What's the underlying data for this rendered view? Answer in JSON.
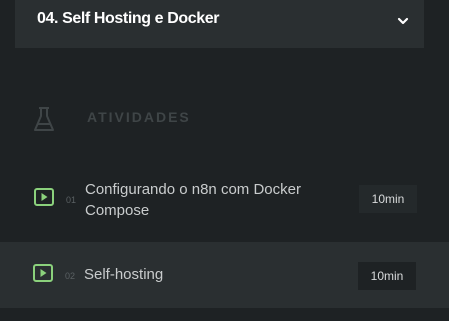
{
  "module": {
    "title": "04. Self Hosting e Docker",
    "toggle_icon": "chevron-down-icon"
  },
  "section": {
    "icon": "flask-icon",
    "label": "ATIVIDADES"
  },
  "lessons": [
    {
      "number": "01",
      "title": "Configurando o n8n com Docker Compose",
      "duration": "10min",
      "icon": "play-icon",
      "highlighted": false
    },
    {
      "number": "02",
      "title": "Self-hosting",
      "duration": "10min",
      "icon": "play-icon",
      "highlighted": true
    }
  ],
  "colors": {
    "background": "#1e2224",
    "panel": "#2a2f31",
    "accent_green": "#8bd17c",
    "text": "#c9cccd",
    "muted": "#3f4547"
  }
}
